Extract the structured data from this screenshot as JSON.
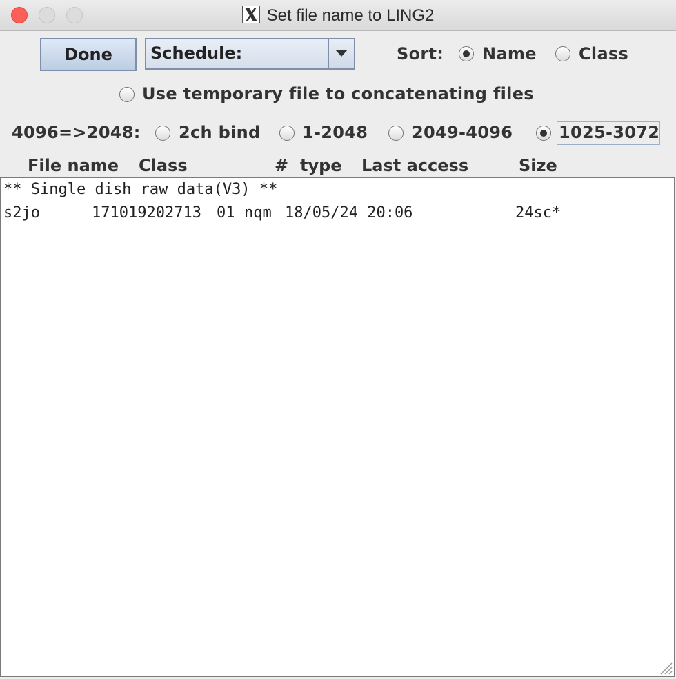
{
  "window": {
    "title": "Set file name to LING2"
  },
  "toolbar": {
    "done_label": "Done",
    "schedule_value": "Schedule:",
    "sort_label": "Sort:",
    "sort_options": [
      {
        "label": "Name",
        "selected": true
      },
      {
        "label": "Class",
        "selected": false
      }
    ]
  },
  "options": {
    "temp_file_label": "Use temporary file to concatenating files",
    "temp_file_selected": false,
    "conversion_label": "4096=>2048:",
    "conversion_options": [
      {
        "label": "2ch bind",
        "selected": false
      },
      {
        "label": "1-2048",
        "selected": false
      },
      {
        "label": "2049-4096",
        "selected": false
      },
      {
        "label": "1025-3072",
        "selected": true
      }
    ]
  },
  "table": {
    "headers": {
      "file_name": "File name",
      "class": "Class",
      "number": "#",
      "type": "type",
      "last_access": "Last access",
      "size": "Size"
    },
    "section_header": "** Single dish raw data(V3) **",
    "rows": [
      {
        "file_name": "s2jo",
        "class": "171019202713",
        "number": "01",
        "type": "nqm",
        "last_access": "18/05/24 20:06",
        "size": "24sc*"
      }
    ]
  }
}
